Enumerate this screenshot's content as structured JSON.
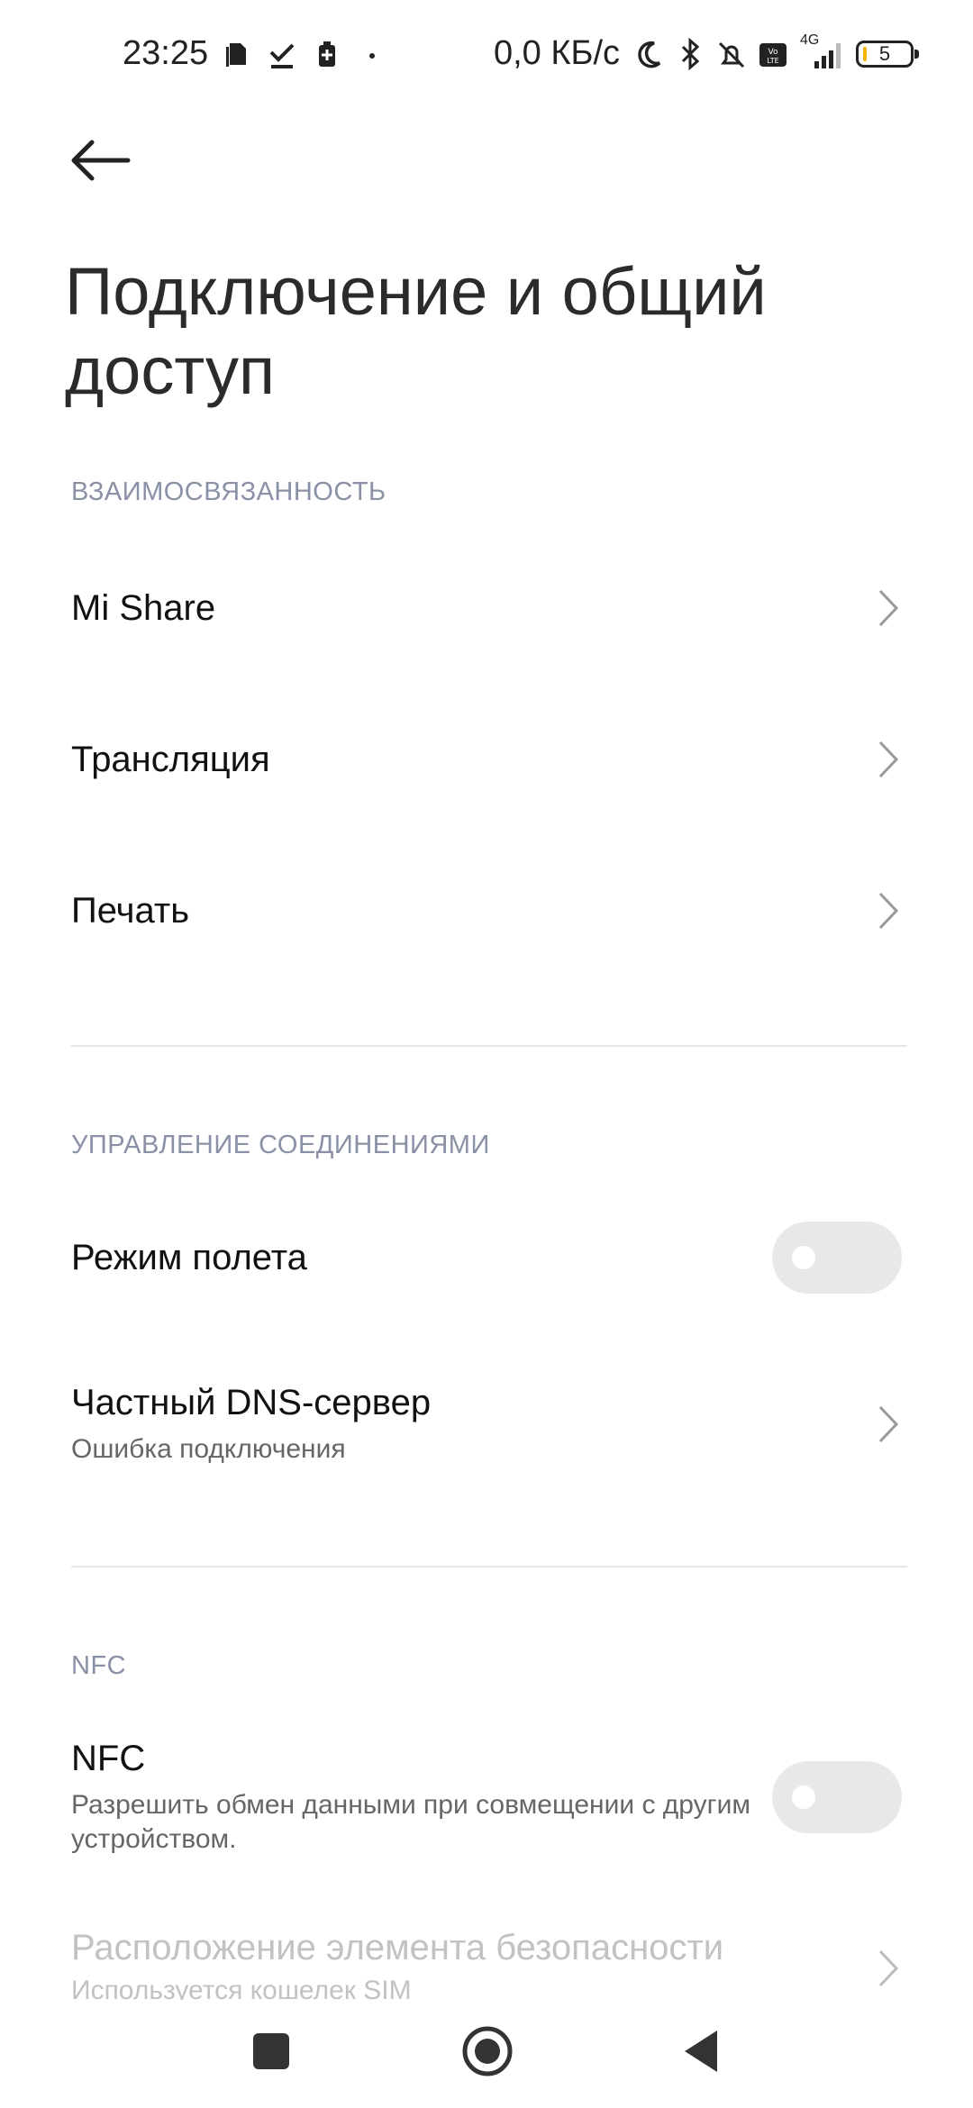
{
  "status_bar": {
    "time": "23:25",
    "net_speed": "0,0 КБ/с",
    "network": "4G",
    "battery_level": "5",
    "icons_left": [
      "sim-card-icon",
      "download-done-icon",
      "battery-saver-icon",
      "dot-icon"
    ],
    "icons_right": [
      "moon-icon",
      "bluetooth-icon",
      "alarm-off-icon",
      "volte-icon",
      "signal-icon",
      "battery-icon"
    ]
  },
  "header": {
    "title": "Подключение и общий доступ"
  },
  "sections": {
    "interconnect": {
      "header": "ВЗАИМОСВЯЗАННОСТЬ",
      "items": [
        {
          "label": "Mi Share"
        },
        {
          "label": "Трансляция"
        },
        {
          "label": "Печать"
        }
      ]
    },
    "connections": {
      "header": "УПРАВЛЕНИЕ СОЕДИНЕНИЯМИ",
      "airplane": {
        "label": "Режим полета",
        "enabled": false
      },
      "dns": {
        "label": "Частный DNS-сервер",
        "sub": "Ошибка подключения"
      }
    },
    "nfc": {
      "header": "NFC",
      "nfc_item": {
        "label": "NFC",
        "sub": "Разрешить обмен данными при совмещении с другим устройством.",
        "enabled": false
      },
      "secure_element": {
        "label": "Расположение элемента безопасности",
        "sub": "Используется кошелек SIM"
      }
    }
  },
  "colors": {
    "section_header": "#8a90a6",
    "toggle_off": "#e8e8e8",
    "divider": "#e6e6e6"
  },
  "nav": {
    "icons": [
      "recent-apps-icon",
      "home-icon",
      "back-icon"
    ]
  }
}
